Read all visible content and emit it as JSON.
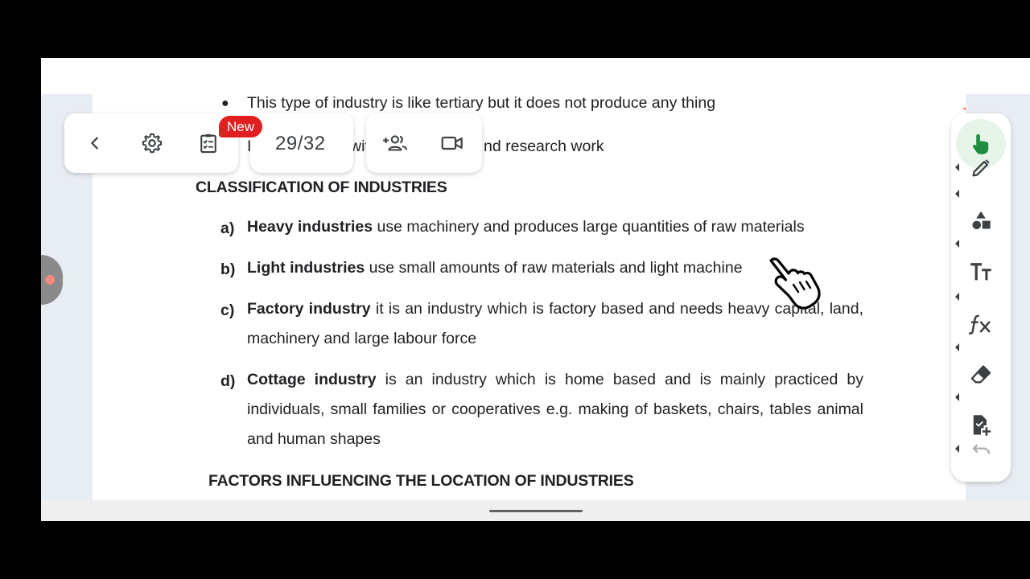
{
  "toolbar": {
    "page_indicator": "29/32",
    "new_badge": "New"
  },
  "document": {
    "bullet_symbol": "●",
    "bullet_line_1": "This type of industry is like tertiary but it does not produce any thing",
    "bullet_line_2_start": "I",
    "bullet_line_2_mid": "wit",
    "bullet_line_2_end": "nd research work",
    "heading_classification": "CLASSIFICATION OF INDUSTRIES",
    "items": [
      {
        "label": "a)",
        "term": "Heavy industries",
        "text": " use machinery and produces large quantities of raw materials"
      },
      {
        "label": "b)",
        "term": "Light industries",
        "text": " use small amounts of raw materials and light machine"
      },
      {
        "label": "c)",
        "term": "Factory industry",
        "text": " it is an industry which is factory based and needs heavy capital, land, machinery and large labour force"
      },
      {
        "label": "d)",
        "term": "Cottage industry",
        "text": " is an industry which is home based and is mainly practiced by individuals, small families or cooperatives e.g. making of baskets, chairs, tables animal and human shapes"
      }
    ],
    "heading_factors": "FACTORS INFLUENCING THE LOCATION OF INDUSTRIES"
  },
  "icons": {
    "back": "chevron-left-icon",
    "settings": "gear-icon",
    "task": "clipboard-checklist-icon",
    "add_people": "add-people-icon",
    "video": "video-camera-icon",
    "hand": "hand-pointer-icon",
    "pen": "pen-icon",
    "shapes": "shapes-icon",
    "text": "text-size-icon",
    "formula": "function-icon",
    "eraser": "eraser-icon",
    "add_page": "add-page-icon",
    "undo": "undo-icon"
  },
  "colors": {
    "accent_green": "#1e8e3e",
    "badge_red": "#e02020"
  }
}
